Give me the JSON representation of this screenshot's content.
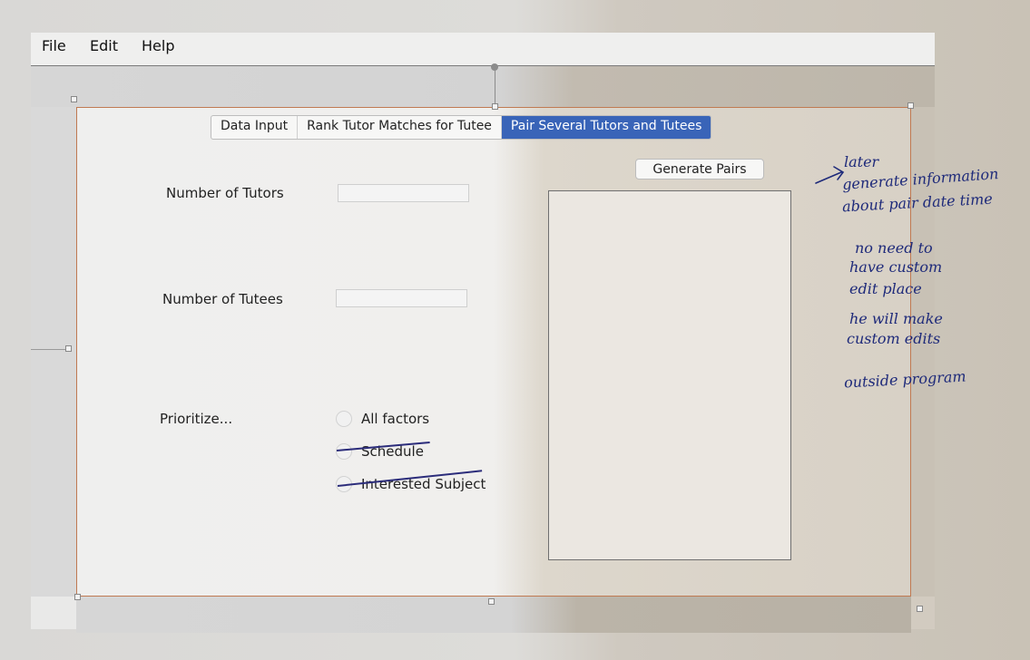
{
  "menu": {
    "file": "File",
    "edit": "Edit",
    "help": "Help"
  },
  "tabs": [
    {
      "label": "Data Input",
      "active": false
    },
    {
      "label": "Rank Tutor Matches for Tutee",
      "active": false
    },
    {
      "label": "Pair Several Tutors and Tutees",
      "active": true
    }
  ],
  "form": {
    "num_tutors_label": "Number of Tutors",
    "num_tutors_value": "",
    "num_tutees_label": "Number of Tutees",
    "num_tutees_value": "",
    "prioritize_label": "Prioritize...",
    "options": [
      "All factors",
      "Schedule",
      "Interested Subject"
    ]
  },
  "generate_button": "Generate Pairs",
  "results_text": "",
  "notes": {
    "line1": "later",
    "line2": "generate information",
    "line3": "about pair date time",
    "line4": "no need to",
    "line5": "have custom",
    "line6": "edit place",
    "line7": "he will make",
    "line8": "custom edits",
    "line9": "outside program"
  },
  "colors": {
    "active_tab": "#3964b8",
    "frame_border": "#c07a52",
    "ink": "#1e2a7a"
  }
}
